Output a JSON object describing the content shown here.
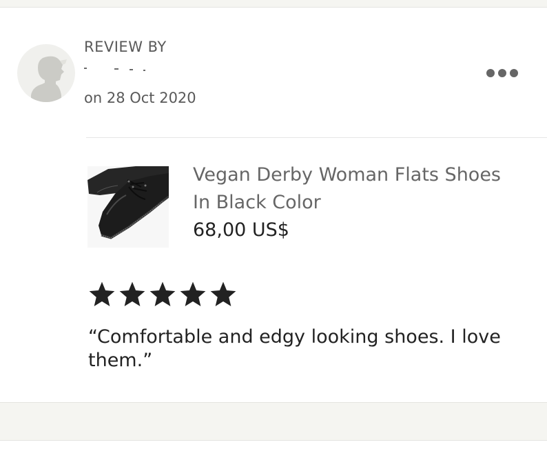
{
  "review": {
    "heading": "REVIEW BY",
    "reviewer_name": "",
    "date": "on 28 Oct 2020",
    "rating": 5,
    "rating_max": 5,
    "text": "“Comfortable and edgy looking shoes. I love them.”"
  },
  "product": {
    "title": "Vegan Derby Woman Flats Shoes In Black Color",
    "price": "68,00 US$",
    "image_subject": "black leather derby shoe with studded sole"
  },
  "menu": {
    "icon": "more-horizontal-icon"
  },
  "colors": {
    "background": "#ffffff",
    "band": "#f5f5f1",
    "muted_text": "#595959",
    "text": "#222222",
    "star": "#222222"
  }
}
